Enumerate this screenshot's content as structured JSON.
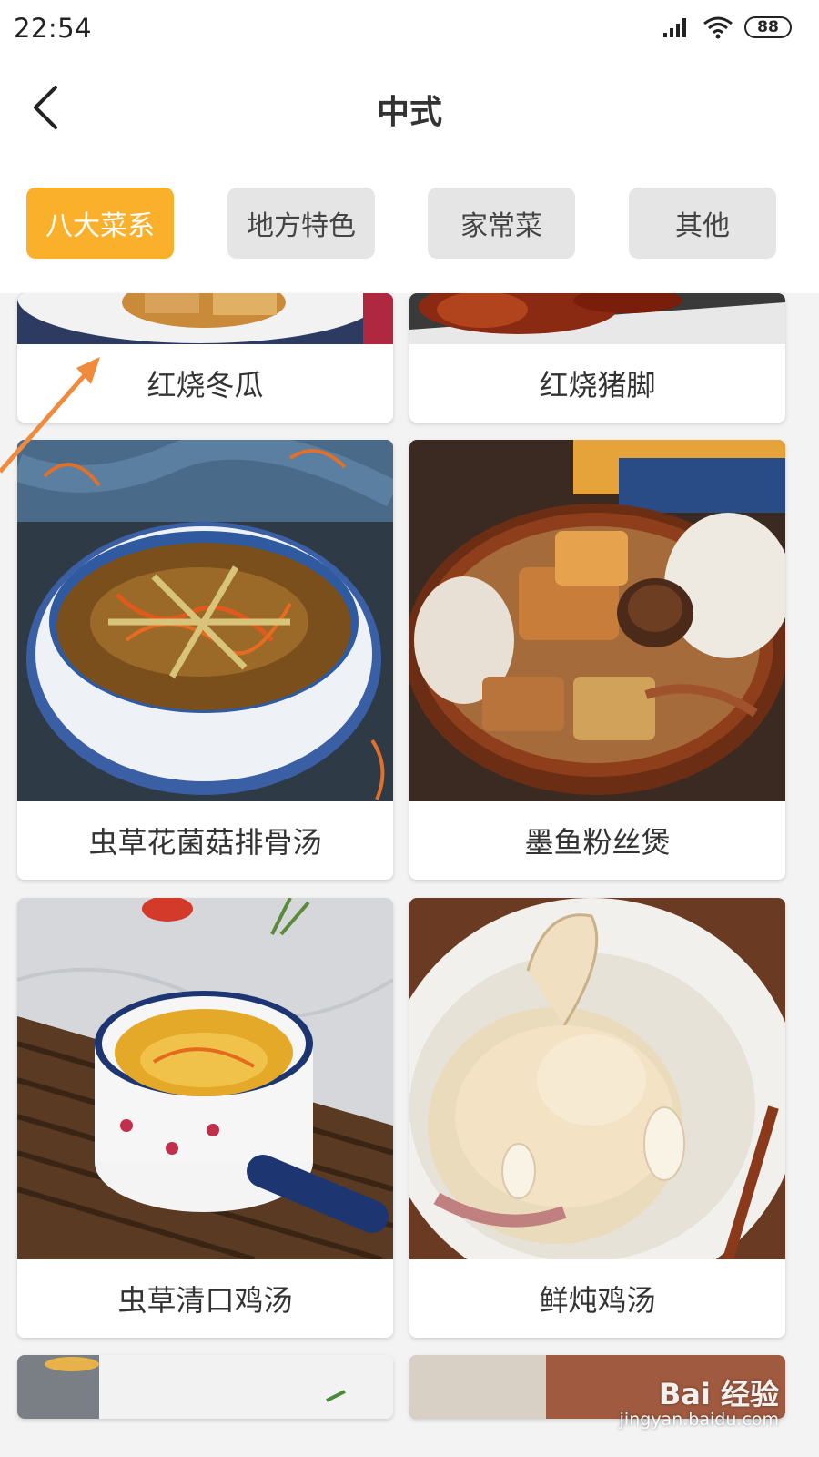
{
  "status_bar": {
    "time": "22:54",
    "battery": "88",
    "icons": [
      "signal-icon",
      "wifi-icon",
      "battery-icon"
    ]
  },
  "header": {
    "title": "中式",
    "back_icon": "chevron-left-icon"
  },
  "tabs": [
    {
      "label": "八大菜系",
      "active": true
    },
    {
      "label": "地方特色",
      "active": false
    },
    {
      "label": "家常菜",
      "active": false
    },
    {
      "label": "其他",
      "active": false
    }
  ],
  "colors": {
    "accent": "#fbb02b",
    "tab_inactive_bg": "#e5e5e5",
    "annotation_arrow": "#f08a3c"
  },
  "dishes": [
    {
      "name": "红烧冬瓜"
    },
    {
      "name": "红烧猪脚"
    },
    {
      "name": "虫草花菌菇排骨汤"
    },
    {
      "name": "墨鱼粉丝煲"
    },
    {
      "name": "虫草清口鸡汤"
    },
    {
      "name": "鲜炖鸡汤"
    }
  ],
  "watermark": {
    "brand": "Bai 经验",
    "url": "jingyan.baidu.com"
  }
}
